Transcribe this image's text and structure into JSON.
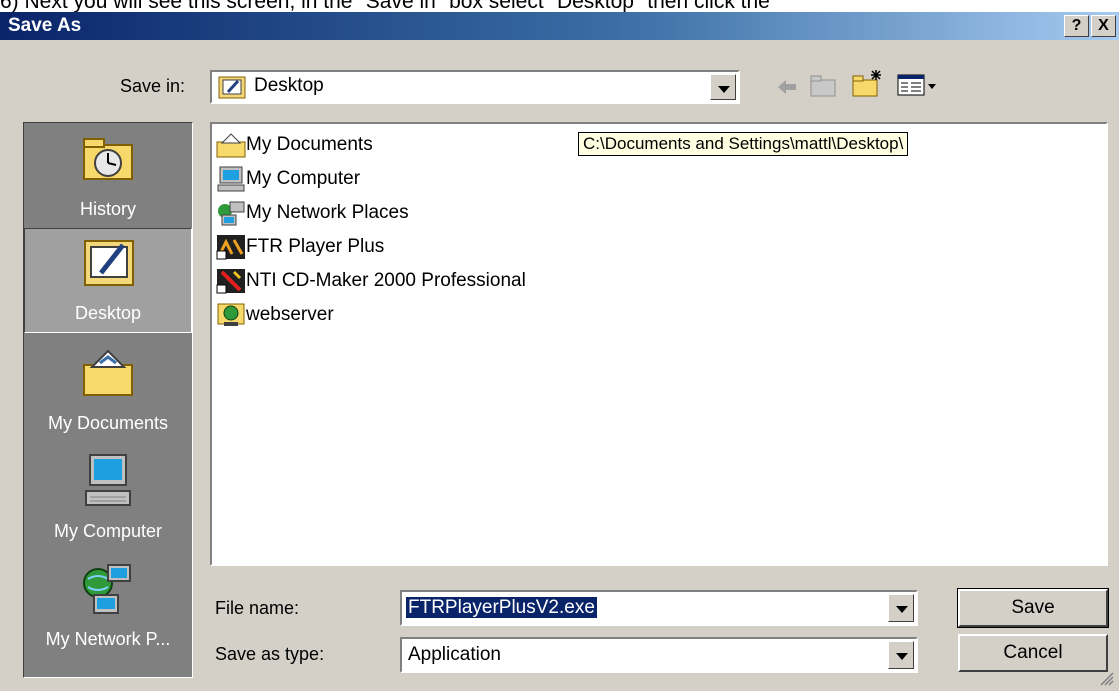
{
  "caption": "6)  Next you will see this screen, in the \"Save in\" box select \"Desktop\" then click the",
  "window": {
    "title": "Save As",
    "help_label": "?",
    "close_label": "X"
  },
  "save_in": {
    "label": "Save in:",
    "value": "Desktop"
  },
  "tooltip": "C:\\Documents and Settings\\mattl\\Desktop\\",
  "places": [
    {
      "label": "History",
      "icon": "history-icon"
    },
    {
      "label": "Desktop",
      "icon": "desktop-icon",
      "active": true
    },
    {
      "label": "My Documents",
      "icon": "my-documents-icon"
    },
    {
      "label": "My Computer",
      "icon": "my-computer-icon"
    },
    {
      "label": "My Network P...",
      "icon": "my-network-places-icon"
    }
  ],
  "files": [
    {
      "name": "My Documents",
      "icon": "my-documents-folder-icon"
    },
    {
      "name": "My Computer",
      "icon": "my-computer-icon"
    },
    {
      "name": "My Network Places",
      "icon": "network-places-icon"
    },
    {
      "name": "FTR Player Plus",
      "icon": "ftr-player-shortcut-icon"
    },
    {
      "name": "NTI CD-Maker 2000 Professional",
      "icon": "nti-cd-maker-shortcut-icon"
    },
    {
      "name": "webserver",
      "icon": "webserver-icon"
    }
  ],
  "file_name": {
    "label": "File name:",
    "value": "FTRPlayerPlusV2.exe"
  },
  "save_as_type": {
    "label": "Save as type:",
    "value": "Application"
  },
  "buttons": {
    "save": "Save",
    "cancel": "Cancel"
  }
}
